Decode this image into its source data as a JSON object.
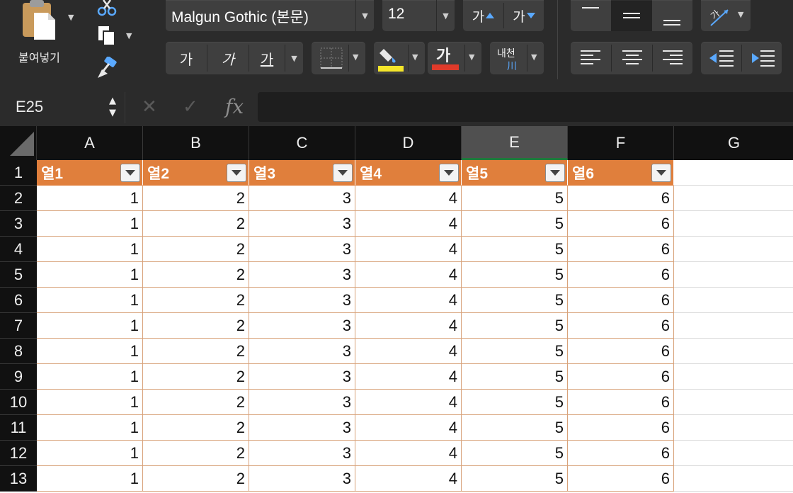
{
  "ribbon": {
    "paste_label": "붙여넣기",
    "font_name": "Malgun Gothic (본문)",
    "font_size": "12",
    "grow_font_glyph": "가",
    "shrink_font_glyph": "가",
    "bold_glyph": "가",
    "italic_glyph": "가",
    "underline_glyph": "가",
    "font_color_glyph": "가",
    "phonetic_glyph": "내천",
    "phonetic_sub_glyph": "川",
    "fill_color": "#f5e62a",
    "font_color": "#e03a2a",
    "accent_blue": "#5aa9ff"
  },
  "formula_bar": {
    "name_box": "E25",
    "cancel_glyph": "✕",
    "enter_glyph": "✓",
    "fx_label": "fx",
    "formula_value": ""
  },
  "grid": {
    "columns": [
      "A",
      "B",
      "C",
      "D",
      "E",
      "F",
      "G"
    ],
    "selected_column": "E",
    "table_header_color": "#e07f3c",
    "table_headers": [
      "열1",
      "열2",
      "열3",
      "열4",
      "열5",
      "열6"
    ],
    "row_numbers": [
      "1",
      "2",
      "3",
      "4",
      "5",
      "6",
      "7",
      "8",
      "9",
      "10",
      "11",
      "12",
      "13"
    ],
    "rows": [
      [
        "1",
        "2",
        "3",
        "4",
        "5",
        "6"
      ],
      [
        "1",
        "2",
        "3",
        "4",
        "5",
        "6"
      ],
      [
        "1",
        "2",
        "3",
        "4",
        "5",
        "6"
      ],
      [
        "1",
        "2",
        "3",
        "4",
        "5",
        "6"
      ],
      [
        "1",
        "2",
        "3",
        "4",
        "5",
        "6"
      ],
      [
        "1",
        "2",
        "3",
        "4",
        "5",
        "6"
      ],
      [
        "1",
        "2",
        "3",
        "4",
        "5",
        "6"
      ],
      [
        "1",
        "2",
        "3",
        "4",
        "5",
        "6"
      ],
      [
        "1",
        "2",
        "3",
        "4",
        "5",
        "6"
      ],
      [
        "1",
        "2",
        "3",
        "4",
        "5",
        "6"
      ],
      [
        "1",
        "2",
        "3",
        "4",
        "5",
        "6"
      ],
      [
        "1",
        "2",
        "3",
        "4",
        "5",
        "6"
      ]
    ]
  }
}
